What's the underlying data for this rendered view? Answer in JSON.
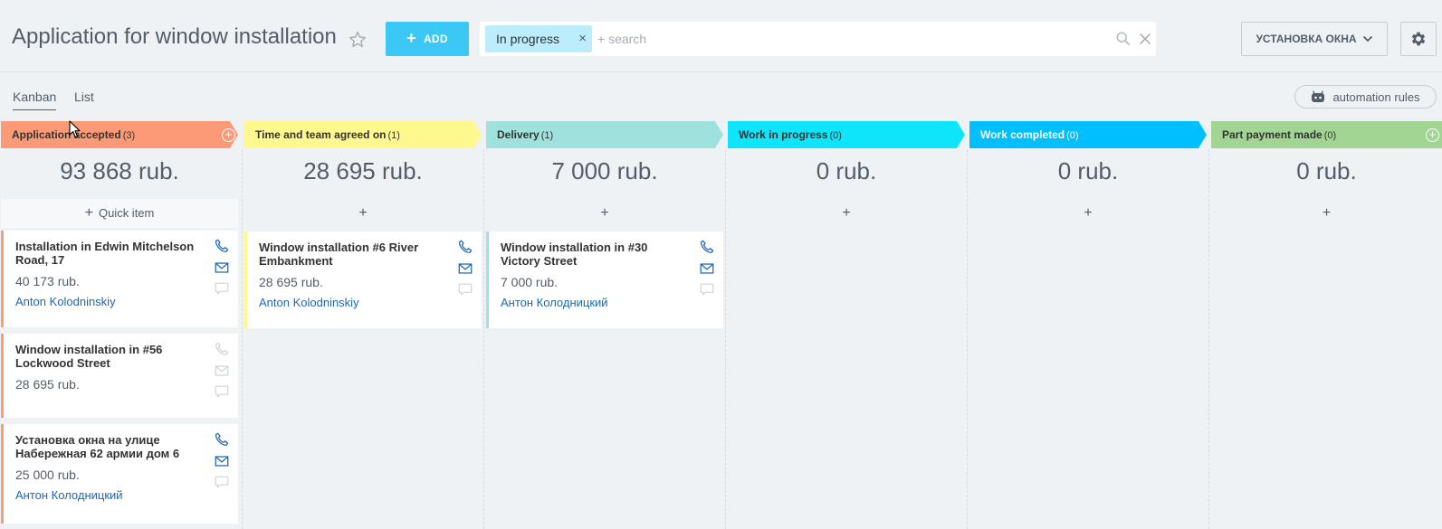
{
  "header": {
    "title": "Application for window installation",
    "add_label": "ADD",
    "filter_tag": "In progress",
    "search_placeholder": "+ search",
    "pipeline_label": "УСТАНОВКА ОКНА"
  },
  "tabs": {
    "kanban": "Kanban",
    "list": "List"
  },
  "automation_label": "automation rules",
  "colors": {
    "accent": "#3bc8f5",
    "link": "#2067b0"
  },
  "columns": [
    {
      "name": "Application accepted",
      "count": "(3)",
      "total": "93 868 rub.",
      "color": "#fc9a78",
      "text_color": "#333333",
      "quick_label": "Quick item"
    },
    {
      "name": "Time and team agreed on",
      "count": "(1)",
      "total": "28 695 rub.",
      "color": "#fff88e",
      "text_color": "#333333"
    },
    {
      "name": "Delivery",
      "count": "(1)",
      "total": "7 000 rub.",
      "color": "#9fe2dd",
      "text_color": "#333333"
    },
    {
      "name": "Work in progress",
      "count": "(0)",
      "total": "0 rub.",
      "color": "#0ee5fa",
      "text_color": "#333333"
    },
    {
      "name": "Work completed",
      "count": "(0)",
      "total": "0 rub.",
      "color": "#00bfff",
      "text_color": "#ffffff"
    },
    {
      "name": "Part payment made",
      "count": "(0)",
      "total": "0 rub.",
      "color": "#a2d494",
      "text_color": "#333333"
    }
  ],
  "cards": [
    {
      "title": "Installation in Edwin Mitchelson Road, 17",
      "sum": "40 173 rub.",
      "user": "Anton Kolodninskiy",
      "icons_active": true
    },
    {
      "title": "Window installation in #56 Lockwood Street",
      "sum": "28 695 rub.",
      "user": "",
      "icons_active": false
    },
    {
      "title": "Установка окна на улице Набережная 62 армии дом 6",
      "sum": "25 000 rub.",
      "user": "Антон Колодницкий",
      "icons_active": true
    },
    {
      "title": "Window installation #6 River Embankment",
      "sum": "28 695 rub.",
      "user": "Anton Kolodninskiy",
      "icons_active": true
    },
    {
      "title": "Window installation in #30 Victory Street",
      "sum": "7 000 rub.",
      "user": "Антон Колодницкий",
      "icons_active": true
    }
  ]
}
